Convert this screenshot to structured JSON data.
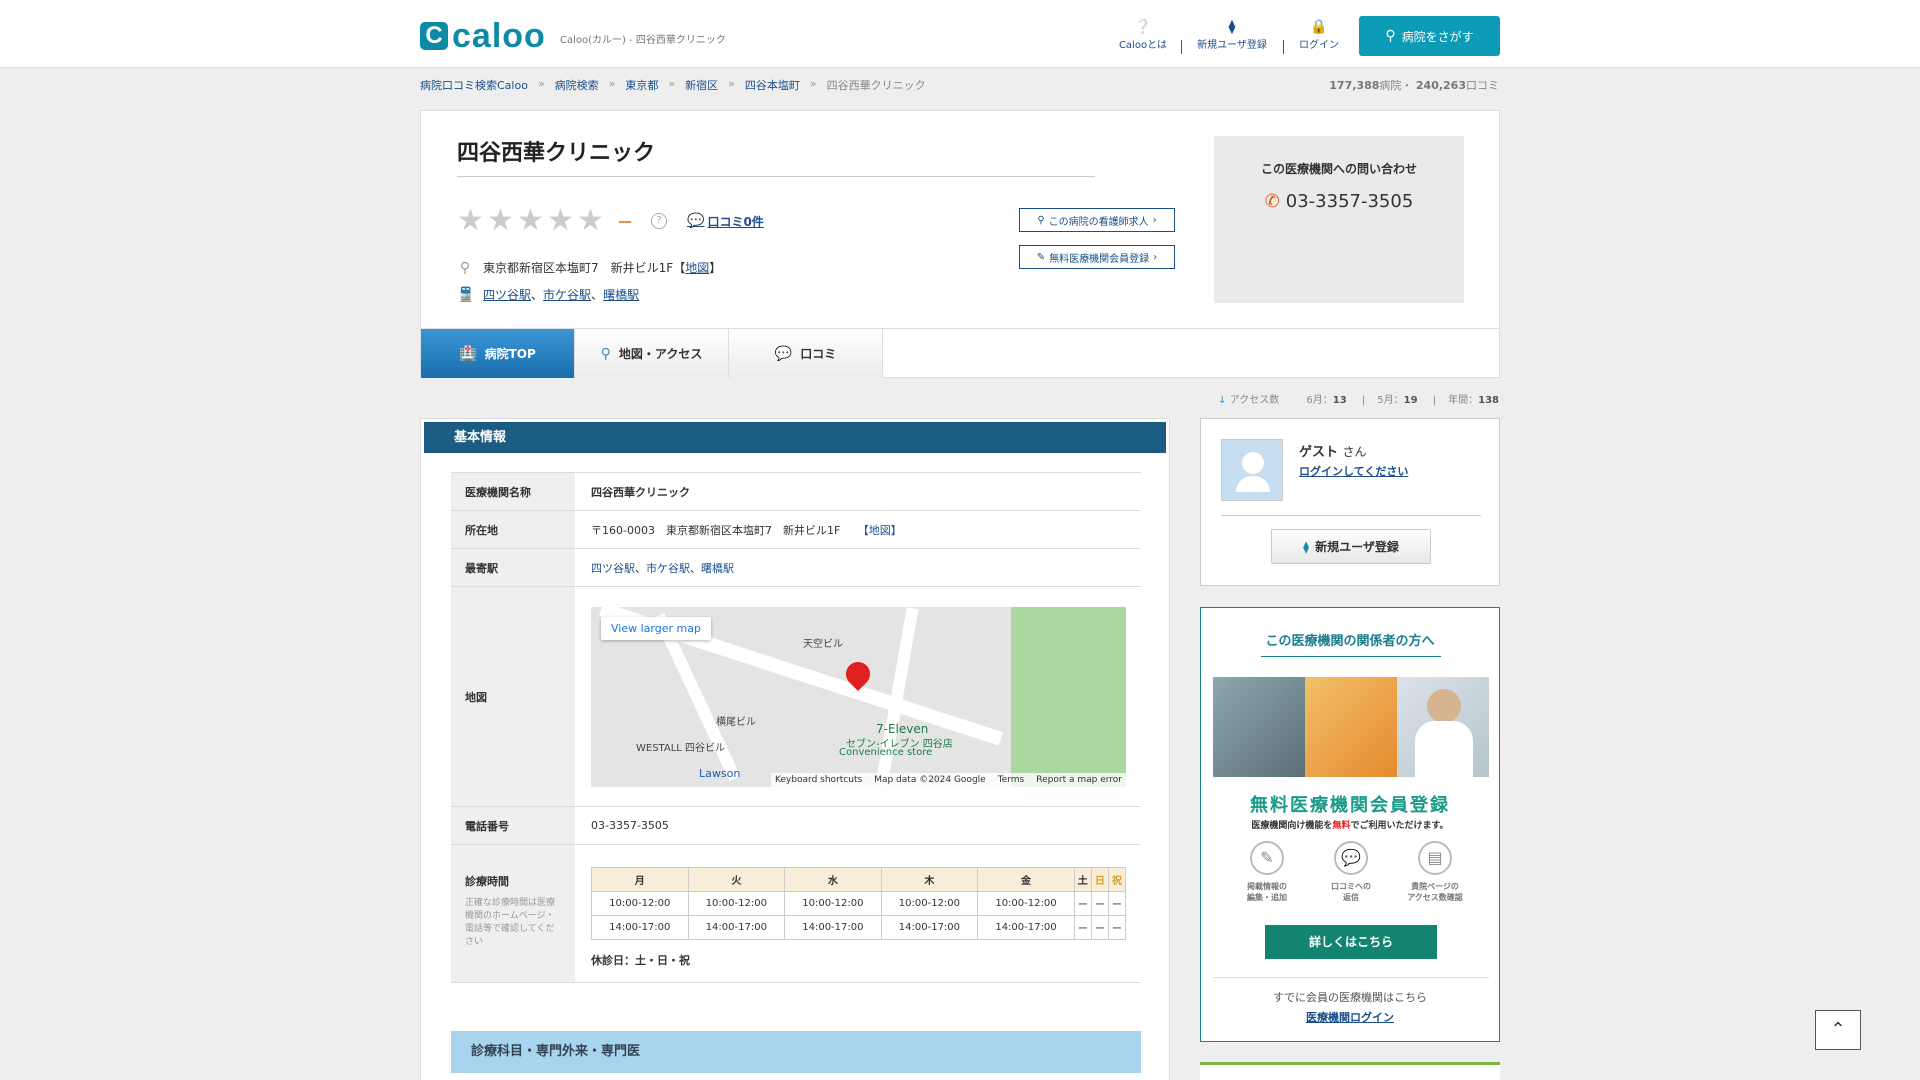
{
  "header": {
    "logo_mark": "C",
    "logo_text": "caloo",
    "tagline": "Caloo(カルー) - 四谷西華クリニック",
    "nav": [
      {
        "icon": "question-circle-icon",
        "label": "Calooとは"
      },
      {
        "icon": "beginner-mark-icon",
        "label": "新規ユーザ登録"
      },
      {
        "icon": "lock-icon",
        "label": "ログイン"
      }
    ],
    "search_label": "病院をさがす"
  },
  "breadcrumb": {
    "items": [
      "病院口コミ検索Caloo",
      "病院検索",
      "東京都",
      "新宿区",
      "四谷本塩町"
    ],
    "current": "四谷西華クリニック"
  },
  "stats": {
    "hospitals": "177,388",
    "hospitals_unit": "病院・",
    "reviews": "240,263",
    "reviews_unit": "口コミ"
  },
  "clinic": {
    "name": "四谷西華クリニック",
    "rating": 0,
    "rating_display": "－",
    "rating_help": "?",
    "review_count_label": "口コミ0件",
    "address": "東京都新宿区本塩町7　新井ビル1F",
    "map_link": "地図",
    "stations": [
      "四ツ谷駅",
      "市ケ谷駅",
      "曙橋駅"
    ]
  },
  "buttons": {
    "nurse_jobs": "この病院の看護師求人",
    "free_registration": "無料医療機関会員登録"
  },
  "contact": {
    "label": "この医療機関への問い合わせ",
    "phone": "03-3357-3505"
  },
  "tabs": [
    {
      "label": "病院TOP",
      "icon": "hospital-icon",
      "active": true
    },
    {
      "label": "地図・アクセス",
      "icon": "map-pin-icon",
      "active": false
    },
    {
      "label": "口コミ",
      "icon": "speech-bubble-icon",
      "active": false
    }
  ],
  "access": {
    "label": "アクセス数",
    "june_label": "6月：",
    "june": "13",
    "may_label": "5月：",
    "may": "19",
    "year_label": "年間：",
    "year": "138"
  },
  "basic_info": {
    "header": "基本情報",
    "rows": {
      "name_label": "医療機関名称",
      "name_value": "四谷西華クリニック",
      "address_label": "所在地",
      "address_value": "〒160-0003　東京都新宿区本塩町7　新井ビル1F",
      "address_map": "【地図】",
      "station_label": "最寄駅",
      "map_label": "地図",
      "phone_label": "電話番号",
      "phone_value": "03-3357-3505",
      "hours_label": "診療時間",
      "hours_note": "正確な診療時間は医療機関のホームページ・電話等で確認してください"
    },
    "map": {
      "larger_map": "View larger map",
      "labels": [
        "天空ビル",
        "横尾ビル",
        "WESTALL 四谷ビル",
        "7-Eleven",
        "セブン-イレブン 四谷店",
        "Convenience store",
        "Lawson"
      ],
      "footer": [
        "Keyboard shortcuts",
        "Map data ©2024 Google",
        "Terms",
        "Report a map error"
      ]
    },
    "hours": {
      "days": [
        "月",
        "火",
        "水",
        "木",
        "金",
        "土",
        "日",
        "祝"
      ],
      "morning": [
        "10:00-12:00",
        "10:00-12:00",
        "10:00-12:00",
        "10:00-12:00",
        "10:00-12:00",
        "ー",
        "ー",
        "ー"
      ],
      "afternoon": [
        "14:00-17:00",
        "14:00-17:00",
        "14:00-17:00",
        "14:00-17:00",
        "14:00-17:00",
        "ー",
        "ー",
        "ー"
      ],
      "closed": "休診日：土・日・祝"
    }
  },
  "departments_header": "診療科目・専門外来・専門医",
  "user": {
    "name": "ゲスト",
    "honorific": "さん",
    "login_prompt": "ログインしてください",
    "register": "新規ユーザ登録"
  },
  "promo": {
    "title": "この医療機関の関係者の方へ",
    "headline": "無料医療機関会員登録",
    "sub_before": "医療機関向け機能を",
    "sub_red": "無料",
    "sub_after": "でご利用いただけます。",
    "features": [
      {
        "icon": "pencil-icon",
        "line1": "掲載情報の",
        "line2": "編集・追加"
      },
      {
        "icon": "chat-icon",
        "line1": "口コミへの",
        "line2": "返信"
      },
      {
        "icon": "bar-chart-icon",
        "line1": "貴院ページの",
        "line2": "アクセス数確認"
      }
    ],
    "detail_button": "詳しくはこちら",
    "already": "すでに会員の医療機関はこちら",
    "clinic_login": "医療機関ログイン"
  },
  "colors": {
    "brand": "#0d8aa6",
    "header_bar": "#1c5c82",
    "tab_active": "#1a6fae",
    "promo_green": "#13846f"
  }
}
